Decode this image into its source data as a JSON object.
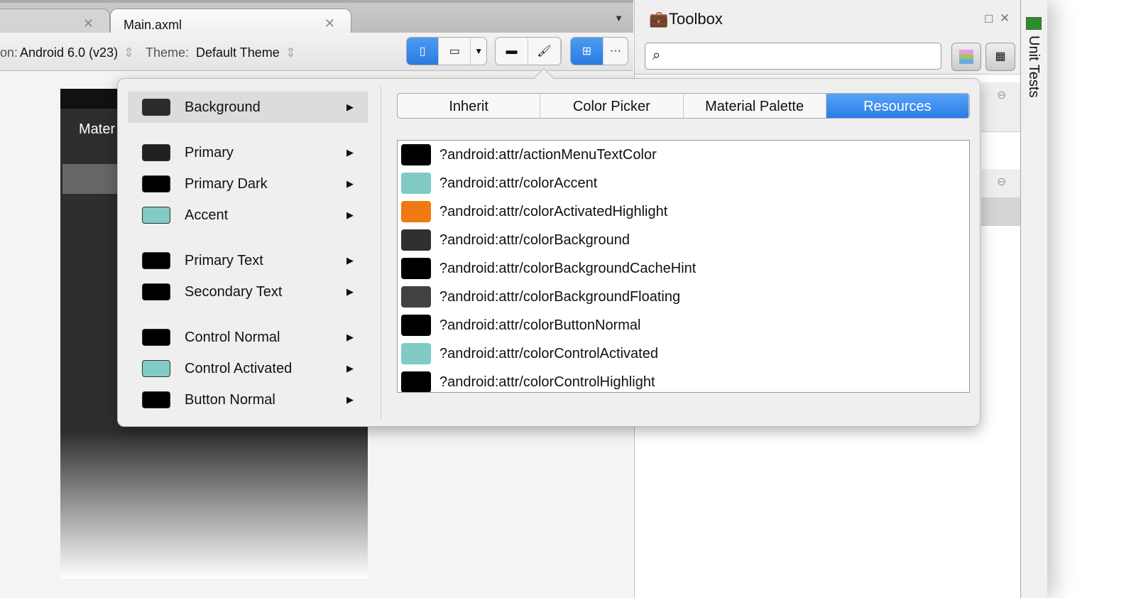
{
  "tabs": [
    {
      "label": ""
    },
    {
      "label": "Main.axml"
    }
  ],
  "toolbar": {
    "version_label": "on:",
    "version_value": "Android 6.0 (v23)",
    "theme_label": "Theme:",
    "theme_value": "Default Theme"
  },
  "phone": {
    "title": "Mater"
  },
  "toolbox": {
    "title": "Toolbox",
    "search_placeholder": ""
  },
  "unit_tests": {
    "label": "Unit Tests"
  },
  "popup": {
    "items": [
      {
        "label": "Background",
        "color": "#2b2b2b"
      },
      {
        "label": "Primary",
        "color": "#212121"
      },
      {
        "label": "Primary Dark",
        "color": "#000000"
      },
      {
        "label": "Accent",
        "color": "#80cbc4"
      },
      {
        "label": "Primary Text",
        "color": "#000000"
      },
      {
        "label": "Secondary Text",
        "color": "#000000"
      },
      {
        "label": "Control Normal",
        "color": "#000000"
      },
      {
        "label": "Control Activated",
        "color": "#80cbc4"
      },
      {
        "label": "Button Normal",
        "color": "#000000"
      }
    ],
    "tabs": [
      "Inherit",
      "Color Picker",
      "Material Palette",
      "Resources"
    ],
    "resources": [
      {
        "name": "?android:attr/actionMenuTextColor",
        "color": "#000000"
      },
      {
        "name": "?android:attr/colorAccent",
        "color": "#80cbc4"
      },
      {
        "name": "?android:attr/colorActivatedHighlight",
        "color": "#ef7a12"
      },
      {
        "name": "?android:attr/colorBackground",
        "color": "#303030"
      },
      {
        "name": "?android:attr/colorBackgroundCacheHint",
        "color": "#000000"
      },
      {
        "name": "?android:attr/colorBackgroundFloating",
        "color": "#424242"
      },
      {
        "name": "?android:attr/colorButtonNormal",
        "color": "#000000"
      },
      {
        "name": "?android:attr/colorControlActivated",
        "color": "#80cbc4"
      },
      {
        "name": "?android:attr/colorControlHighlight",
        "color": "#000000"
      }
    ]
  }
}
